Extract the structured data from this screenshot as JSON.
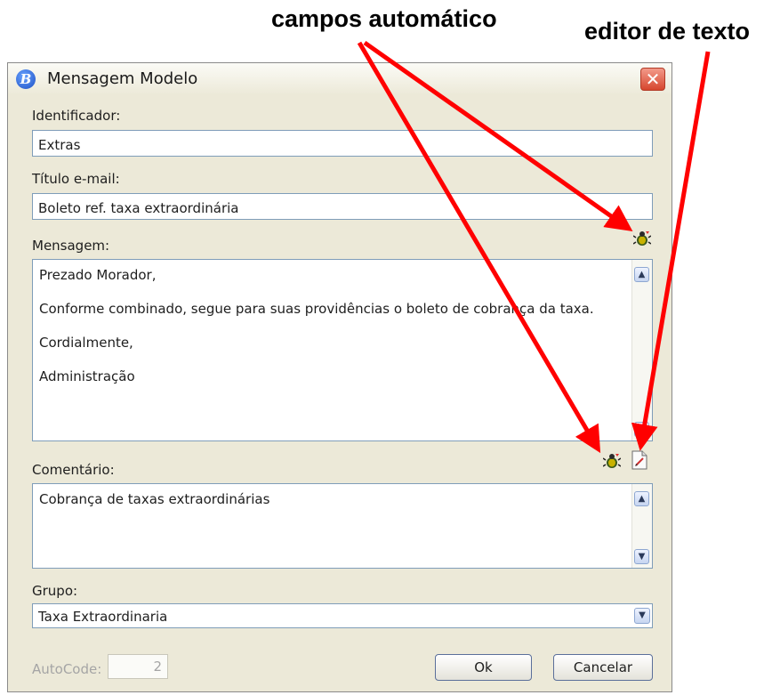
{
  "annotations": {
    "auto_fields": "campos automático",
    "text_editor": "editor de texto"
  },
  "window": {
    "title": "Mensagem Modelo",
    "app_icon_letter": "B",
    "close_glyph": "✕"
  },
  "form": {
    "identificador_label": "Identificador:",
    "identificador_value": "Extras",
    "titulo_label": "Título e-mail:",
    "titulo_value": "Boleto ref. taxa extraordinária",
    "mensagem_label": "Mensagem:",
    "mensagem_lines": [
      "Prezado Morador,",
      "Conforme combinado, segue para suas providências o boleto de cobrança da taxa.",
      "Cordialmente,",
      "Administração"
    ],
    "comentario_label": "Comentário:",
    "comentario_value": "Cobrança de taxas extraordinárias",
    "grupo_label": "Grupo:",
    "grupo_value": "Taxa Extraordinaria",
    "autocode_label": "AutoCode:",
    "autocode_value": "2"
  },
  "buttons": {
    "ok": "Ok",
    "cancel": "Cancelar"
  },
  "icons": {
    "auto_field_icon": "bug-insert-field-icon",
    "editor_icon": "text-editor-icon",
    "scroll_up": "▲",
    "scroll_down": "▼",
    "combo_down": "▼"
  },
  "colors": {
    "annotation_arrow": "#ff0000",
    "field_border": "#7f9db9",
    "window_bg": "#ece9d8"
  }
}
